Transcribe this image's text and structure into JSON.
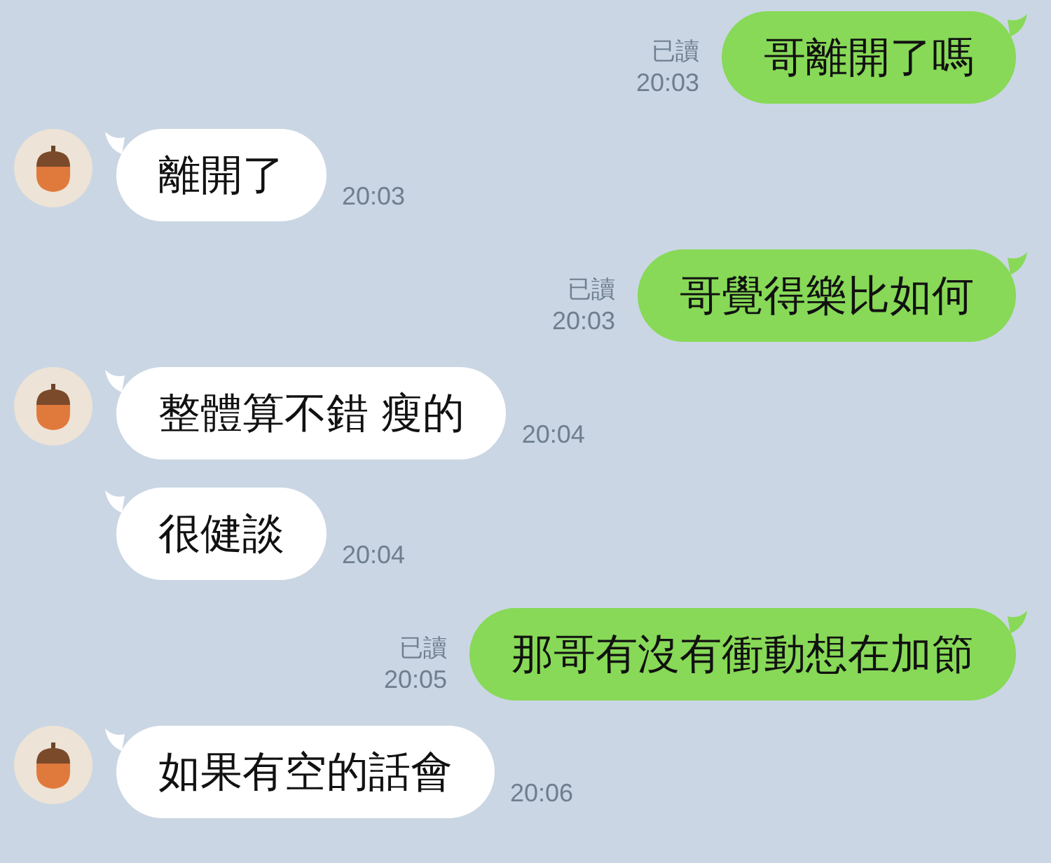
{
  "messages": [
    {
      "kind": "outgoing",
      "text": "哥離開了嗎",
      "read_label": "已讀",
      "time": "20:03"
    },
    {
      "kind": "incoming",
      "show_avatar": true,
      "text": "離開了",
      "time": "20:03"
    },
    {
      "kind": "outgoing",
      "text": "哥覺得樂比如何",
      "read_label": "已讀",
      "time": "20:03"
    },
    {
      "kind": "incoming",
      "show_avatar": true,
      "text": "整體算不錯 瘦的",
      "time": "20:04"
    },
    {
      "kind": "incoming",
      "show_avatar": false,
      "text": "很健談",
      "time": "20:04"
    },
    {
      "kind": "outgoing",
      "text": "那哥有沒有衝動想在加節",
      "read_label": "已讀",
      "time": "20:05"
    },
    {
      "kind": "incoming",
      "show_avatar": true,
      "text": "如果有空的話會",
      "time": "20:06"
    }
  ]
}
